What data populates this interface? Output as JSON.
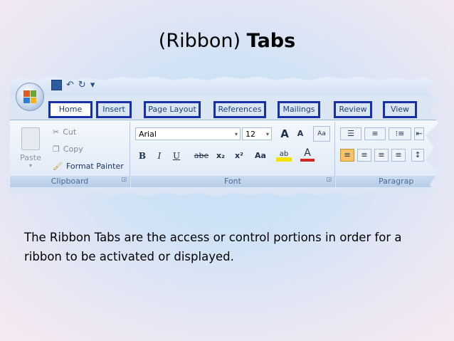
{
  "slide": {
    "title_plain": "(Ribbon)",
    "title_bold": "Tabs",
    "body": "The Ribbon Tabs are the access or control portions in order for a ribbon to be activated or displayed."
  },
  "ribbon": {
    "tabs": [
      "Home",
      "Insert",
      "Page Layout",
      "References",
      "Mailings",
      "Review",
      "View"
    ],
    "clipboard": {
      "paste": "Paste",
      "cut": "Cut",
      "copy": "Copy",
      "format_painter": "Format Painter",
      "group_label": "Clipboard"
    },
    "font": {
      "font_name": "Arial",
      "font_size": "12",
      "group_label": "Font",
      "bold": "B",
      "italic": "I",
      "underline": "U",
      "strike": "abe",
      "subscript": "x₂",
      "superscript": "x²",
      "change_case": "Aa",
      "grow": "A",
      "shrink": "A",
      "highlight": "ab",
      "font_color": "A"
    },
    "paragraph": {
      "group_label": "Paragrap"
    }
  },
  "colors": {
    "tab_highlight": "#1530a8",
    "tab_text": "#1e3f73",
    "ribbon_bg": "#dce8f6",
    "highlight_yellow": "#f5e400",
    "font_color_red": "#d2261f"
  }
}
